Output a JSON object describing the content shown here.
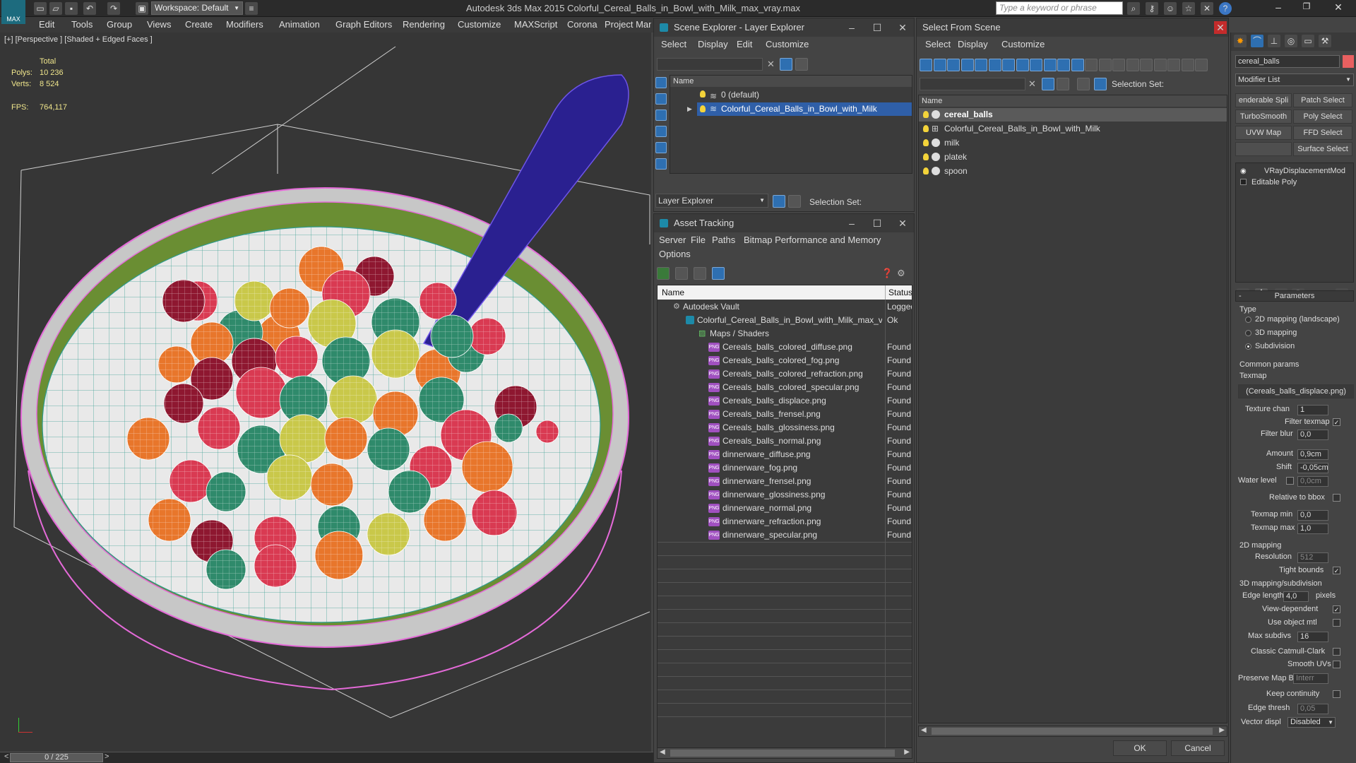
{
  "app": {
    "logo_text": "MAX",
    "title": "Autodesk 3ds Max  2015     Colorful_Cereal_Balls_in_Bowl_with_Milk_max_vray.max",
    "workspace": "Workspace: Default",
    "search_placeholder": "Type a keyword or phrase"
  },
  "menu": [
    "Edit",
    "Tools",
    "Group",
    "Views",
    "Create",
    "Modifiers",
    "Animation",
    "Graph Editors",
    "Rendering",
    "Customize",
    "MAXScript",
    "Corona",
    "Project Man"
  ],
  "viewport": {
    "label": "[+] [Perspective ] [Shaded + Edged Faces ]",
    "stats_total": "Total",
    "polys_label": "Polys:",
    "polys_value": "10 236",
    "verts_label": "Verts:",
    "verts_value": "8 524",
    "fps_label": "FPS:",
    "fps_value": "764,117"
  },
  "timeline": {
    "frame": "0 / 225",
    "prev": "<",
    "next": ">"
  },
  "scene_explorer": {
    "title": "Scene Explorer - Layer Explorer",
    "menu": [
      "Select",
      "Display",
      "Edit",
      "Customize"
    ],
    "column": "Name",
    "rows": [
      {
        "name": "0 (default)",
        "selected": false
      },
      {
        "name": "Colorful_Cereal_Balls_in_Bowl_with_Milk",
        "selected": true
      }
    ],
    "footer_dropdown": "Layer Explorer",
    "selection_set": "Selection Set:"
  },
  "asset_tracking": {
    "title": "Asset Tracking",
    "menu": [
      "Server",
      "File",
      "Paths",
      "Bitmap Performance and Memory"
    ],
    "menu2": "Options",
    "col_name": "Name",
    "col_status": "Status",
    "vault": {
      "name": "Autodesk Vault",
      "status": "Logged"
    },
    "file": {
      "name": "Colorful_Cereal_Balls_in_Bowl_with_Milk_max_vr...",
      "status": "Ok"
    },
    "folder": "Maps / Shaders",
    "files": [
      {
        "name": "Cereals_balls_colored_diffuse.png",
        "status": "Found"
      },
      {
        "name": "Cereals_balls_colored_fog.png",
        "status": "Found"
      },
      {
        "name": "Cereals_balls_colored_refraction.png",
        "status": "Found"
      },
      {
        "name": "Cereals_balls_colored_specular.png",
        "status": "Found"
      },
      {
        "name": "Cereals_balls_displace.png",
        "status": "Found"
      },
      {
        "name": "Cereals_balls_frensel.png",
        "status": "Found"
      },
      {
        "name": "Cereals_balls_glossiness.png",
        "status": "Found"
      },
      {
        "name": "Cereals_balls_normal.png",
        "status": "Found"
      },
      {
        "name": "dinnerware_diffuse.png",
        "status": "Found"
      },
      {
        "name": "dinnerware_fog.png",
        "status": "Found"
      },
      {
        "name": "dinnerware_frensel.png",
        "status": "Found"
      },
      {
        "name": "dinnerware_glossiness.png",
        "status": "Found"
      },
      {
        "name": "dinnerware_normal.png",
        "status": "Found"
      },
      {
        "name": "dinnerware_refraction.png",
        "status": "Found"
      },
      {
        "name": "dinnerware_specular.png",
        "status": "Found"
      }
    ]
  },
  "select_from_scene": {
    "title": "Select From Scene",
    "menu": [
      "Select",
      "Display",
      "Customize"
    ],
    "selection_set": "Selection Set:",
    "column": "Name",
    "rows": [
      {
        "name": "cereal_balls",
        "selected": true
      },
      {
        "name": "Colorful_Cereal_Balls_in_Bowl_with_Milk",
        "selected": false
      },
      {
        "name": "milk",
        "selected": false
      },
      {
        "name": "platek",
        "selected": false
      },
      {
        "name": "spoon",
        "selected": false
      }
    ],
    "ok": "OK",
    "cancel": "Cancel"
  },
  "command_panel": {
    "object_name": "cereal_balls",
    "modifier_list": "Modifier List",
    "buttons": [
      "enderable Spli",
      "Patch Select",
      "TurboSmooth",
      "Poly Select",
      "UVW Map",
      "FFD Select",
      "Surface Select"
    ],
    "stack": [
      "VRayDisplacementMod",
      "Editable Poly"
    ],
    "rollout": "Parameters",
    "type_label": "Type",
    "types": [
      {
        "label": "2D mapping (landscape)",
        "on": false
      },
      {
        "label": "3D mapping",
        "on": false
      },
      {
        "label": "Subdivision",
        "on": true
      }
    ],
    "common_params": "Common params",
    "texmap_label": "Texmap",
    "texmap_value": "(Cereals_balls_displace.png)",
    "texture_chan_label": "Texture chan",
    "texture_chan": "1",
    "filter_texmap": "Filter texmap",
    "filter_blur_label": "Filter blur",
    "filter_blur": "0,0",
    "amount_label": "Amount",
    "amount": "0,9cm",
    "shift_label": "Shift",
    "shift": "-0,05cm",
    "water_level_label": "Water level",
    "water_level": "0,0cm",
    "relative_bbox": "Relative to bbox",
    "texmap_min_label": "Texmap min",
    "texmap_min": "0,0",
    "texmap_max_label": "Texmap max",
    "texmap_max": "1,0",
    "mapping2d": "2D mapping",
    "resolution_label": "Resolution",
    "resolution": "512",
    "tight_bounds": "Tight bounds",
    "mapping3d": "3D mapping/subdivision",
    "edge_length_label": "Edge length",
    "edge_length": "4,0",
    "pixels": "pixels",
    "view_dependent": "View-dependent",
    "use_object_mtl": "Use object mtl",
    "max_subdivs_label": "Max subdivs",
    "max_subdivs": "16",
    "classic_catmull": "Classic Catmull-Clark",
    "smooth_uvs": "Smooth UVs",
    "preserve_map_label": "Preserve Map Bnd",
    "preserve_map": "Interr",
    "keep_continuity": "Keep continuity",
    "edge_thresh_label": "Edge thresh",
    "edge_thresh": "0,05",
    "vector_displ_label": "Vector displ",
    "vector_displ": "Disabled"
  },
  "colors": {
    "accent": "#2e6fb1",
    "selection": "#2f5fa8",
    "panel": "#444444",
    "title": "#2b2b2b"
  }
}
